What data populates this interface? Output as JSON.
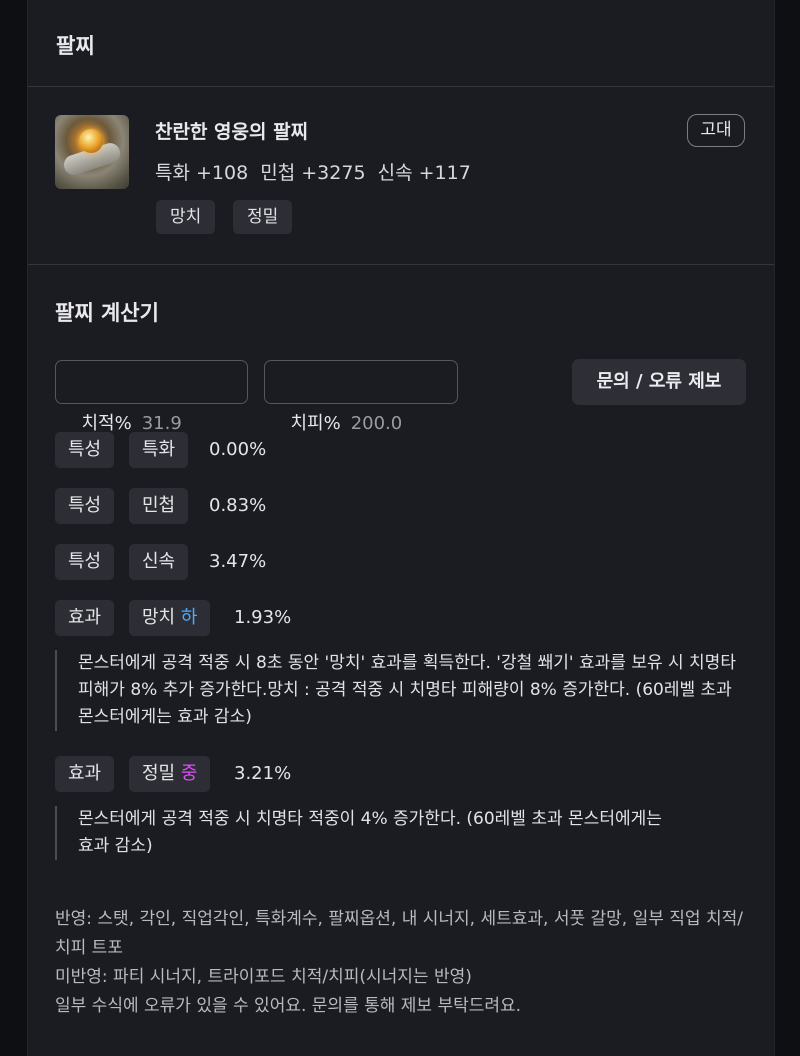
{
  "header": {
    "title": "팔찌"
  },
  "item": {
    "name": "찬란한 영웅의 팔찌",
    "stats": "특화 +108  민첩 +3275  신속 +117",
    "grade": "고대",
    "tags": [
      "망치",
      "정밀"
    ],
    "icon": "bracelet-icon"
  },
  "calculator": {
    "title": "팔찌 계산기",
    "crit_rate": {
      "label": "치적%",
      "value": "31.9"
    },
    "crit_damage": {
      "label": "치피%",
      "value": "200.0"
    },
    "report_button": "문의 / 오류 제보",
    "rows": [
      {
        "category": "특성",
        "name": "특화",
        "grade": "",
        "percent": "0.00%"
      },
      {
        "category": "특성",
        "name": "민첩",
        "grade": "",
        "percent": "0.83%"
      },
      {
        "category": "특성",
        "name": "신속",
        "grade": "",
        "percent": "3.47%"
      },
      {
        "category": "효과",
        "name": "망치",
        "grade": "하",
        "percent": "1.93%",
        "description": "몬스터에게 공격 적중 시 8초 동안 '망치' 효과를 획득한다. '강철 쐐기' 효과를 보유 시 치명타 피해가 8% 추가 증가한다.망치 : 공격 적중 시 치명타 피해량이 8% 증가한다. (60레벨 초과 몬스터에게는 효과 감소)"
      },
      {
        "category": "효과",
        "name": "정밀",
        "grade": "중",
        "percent": "3.21%",
        "description": "몬스터에게 공격 적중 시 치명타 적중이 4% 증가한다. (60레벨 초과 몬스터에게는 효과 감소)"
      }
    ],
    "colors": {
      "grade_low": "#4ea9ff",
      "grade_mid": "#e14bff"
    }
  },
  "footer": {
    "applied": "반영: 스탯, 각인, 직업각인, 특화계수, 팔찌옵션, 내 시너지, 세트효과, 서풋 갈망, 일부 직업 치적/치피 트포",
    "not_applied": "미반영: 파티 시너지, 트라이포드 치적/치피(시너지는 반영)",
    "notice": "일부 수식에 오류가 있을 수 있어요. 문의를 통해 제보 부탁드려요."
  }
}
